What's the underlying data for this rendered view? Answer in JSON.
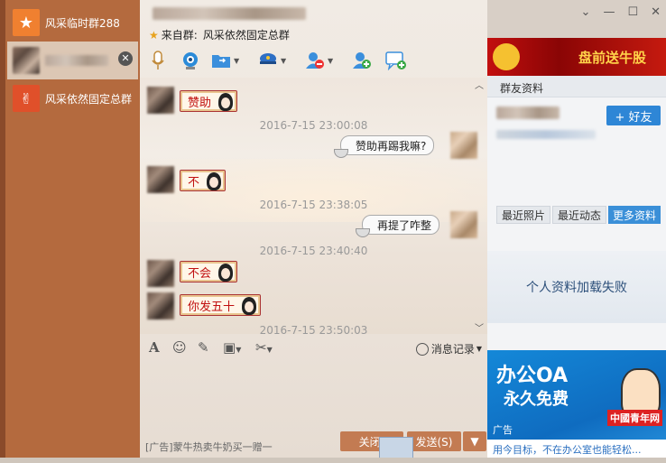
{
  "sessions": [
    {
      "label": "风采临时群288",
      "icon": "star-icon",
      "selected": false
    },
    {
      "label": "",
      "icon": "avatar-blurred",
      "selected": true
    },
    {
      "label": "风采依然固定总群",
      "icon": "rock-hand-icon",
      "selected": false
    }
  ],
  "window": {
    "subtitle_prefix": "来自群:",
    "subtitle_group": "风采依然固定总群"
  },
  "toolbar": {
    "voice": "microphone-icon",
    "video": "camera-icon",
    "file": "folder-icon",
    "screen": "captain-icon",
    "remove": "remove-user-icon",
    "add": "add-user-icon",
    "message": "add-message-icon"
  },
  "chat": {
    "messages": [
      {
        "side": "left",
        "text": "赞助"
      },
      {
        "type": "time",
        "text": "2016-7-15 23:00:08"
      },
      {
        "side": "right",
        "text": "赞助再踢我嘛?"
      },
      {
        "side": "left",
        "text": "不"
      },
      {
        "type": "time",
        "text": "2016-7-15 23:38:05"
      },
      {
        "side": "right",
        "text": "再提了咋整"
      },
      {
        "type": "time",
        "text": "2016-7-15 23:40:40"
      },
      {
        "side": "left",
        "text": "不会"
      },
      {
        "side": "left",
        "text": "你发五十"
      },
      {
        "type": "time",
        "text": "2016-7-15 23:50:03"
      }
    ]
  },
  "input_toolbar": {
    "history_label": "消息记录"
  },
  "footer": {
    "ad_text": "[广告]蒙牛热卖牛奶买一赠一",
    "close_label": "关闭(",
    "send_label": "发送(S)"
  },
  "right_panel": {
    "banner_text": "盘前送牛股",
    "title": "群友资料",
    "add_friend": "+ 好友",
    "tabs": [
      "最近照片",
      "最近动态",
      "更多资料"
    ],
    "active_tab": 2,
    "fail_text": "个人资料加载失败",
    "ad_line1": "办公OA",
    "ad_line2": "永久免费",
    "ad_label": "广告",
    "ad_logo": "中國青年网",
    "ad_bottom": "用今目标，不在办公室也能轻松..."
  }
}
